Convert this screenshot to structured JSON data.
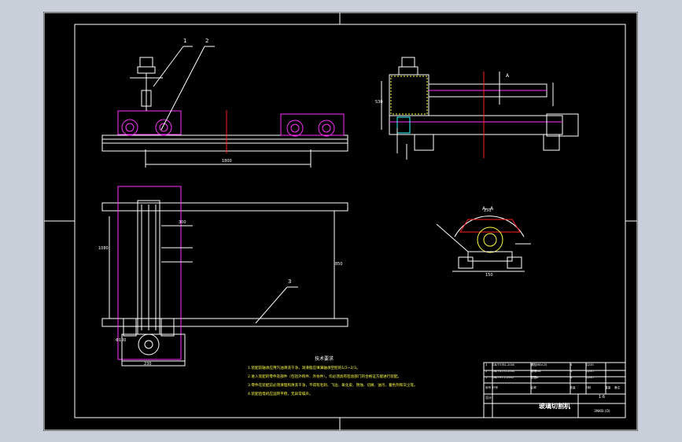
{
  "drawing": {
    "title": "玻璃切割机",
    "scale": "1:6",
    "sheet_ref": "3NKB.(D)",
    "tech_requirements": {
      "heading": "技术要求",
      "items": [
        "1.装配前轴承应用汽油清洗干净，润滑脂应填满轴承空腔的1/2~2/3。",
        "2.进入装配的零件及部件（包括外购件、外协件），均必须具有检验部门的合格证方能进行装配。",
        "3.零件在装配前必须清理和清洗干净，不得有毛刺、飞边、氧化皮、锈蚀、切屑、油污、着色剂和灰尘等。",
        "4.装配后电机应运转平稳，无异常噪声。"
      ]
    },
    "balloons": [
      "1",
      "2",
      "3"
    ],
    "section_label": "A—A",
    "view_marker": "A",
    "dimensions": {
      "front_length": "1800",
      "plan_height": "850",
      "plan_width": "300",
      "plan_inner": "1080",
      "base_width": "230",
      "bottom_width": "250",
      "section_width": "150",
      "side_height": "530",
      "pulley": "Φ100"
    },
    "title_block": {
      "headers": [
        "序号",
        "代号",
        "名称",
        "数量",
        "材料",
        "重量",
        "备注"
      ],
      "rows": [
        [
          "3",
          "GB/T5781-2000",
          "螺栓M8×20",
          "4",
          "Q235",
          "",
          ""
        ],
        [
          "2",
          "GB/T6170-2000",
          "螺母M8",
          "4",
          "Q235",
          "",
          ""
        ],
        [
          "1",
          "GB/T97.1-2002",
          "垫圈8",
          "4",
          "Q235",
          "",
          ""
        ]
      ],
      "design_label": "设计"
    },
    "colors": {
      "background": "#000000",
      "line": "#ffffff",
      "accent_red": "#ff2020",
      "accent_magenta": "#ff30ff",
      "accent_yellow": "#ffff40",
      "accent_cyan": "#30ffff",
      "accent_green": "#40ff40"
    }
  }
}
